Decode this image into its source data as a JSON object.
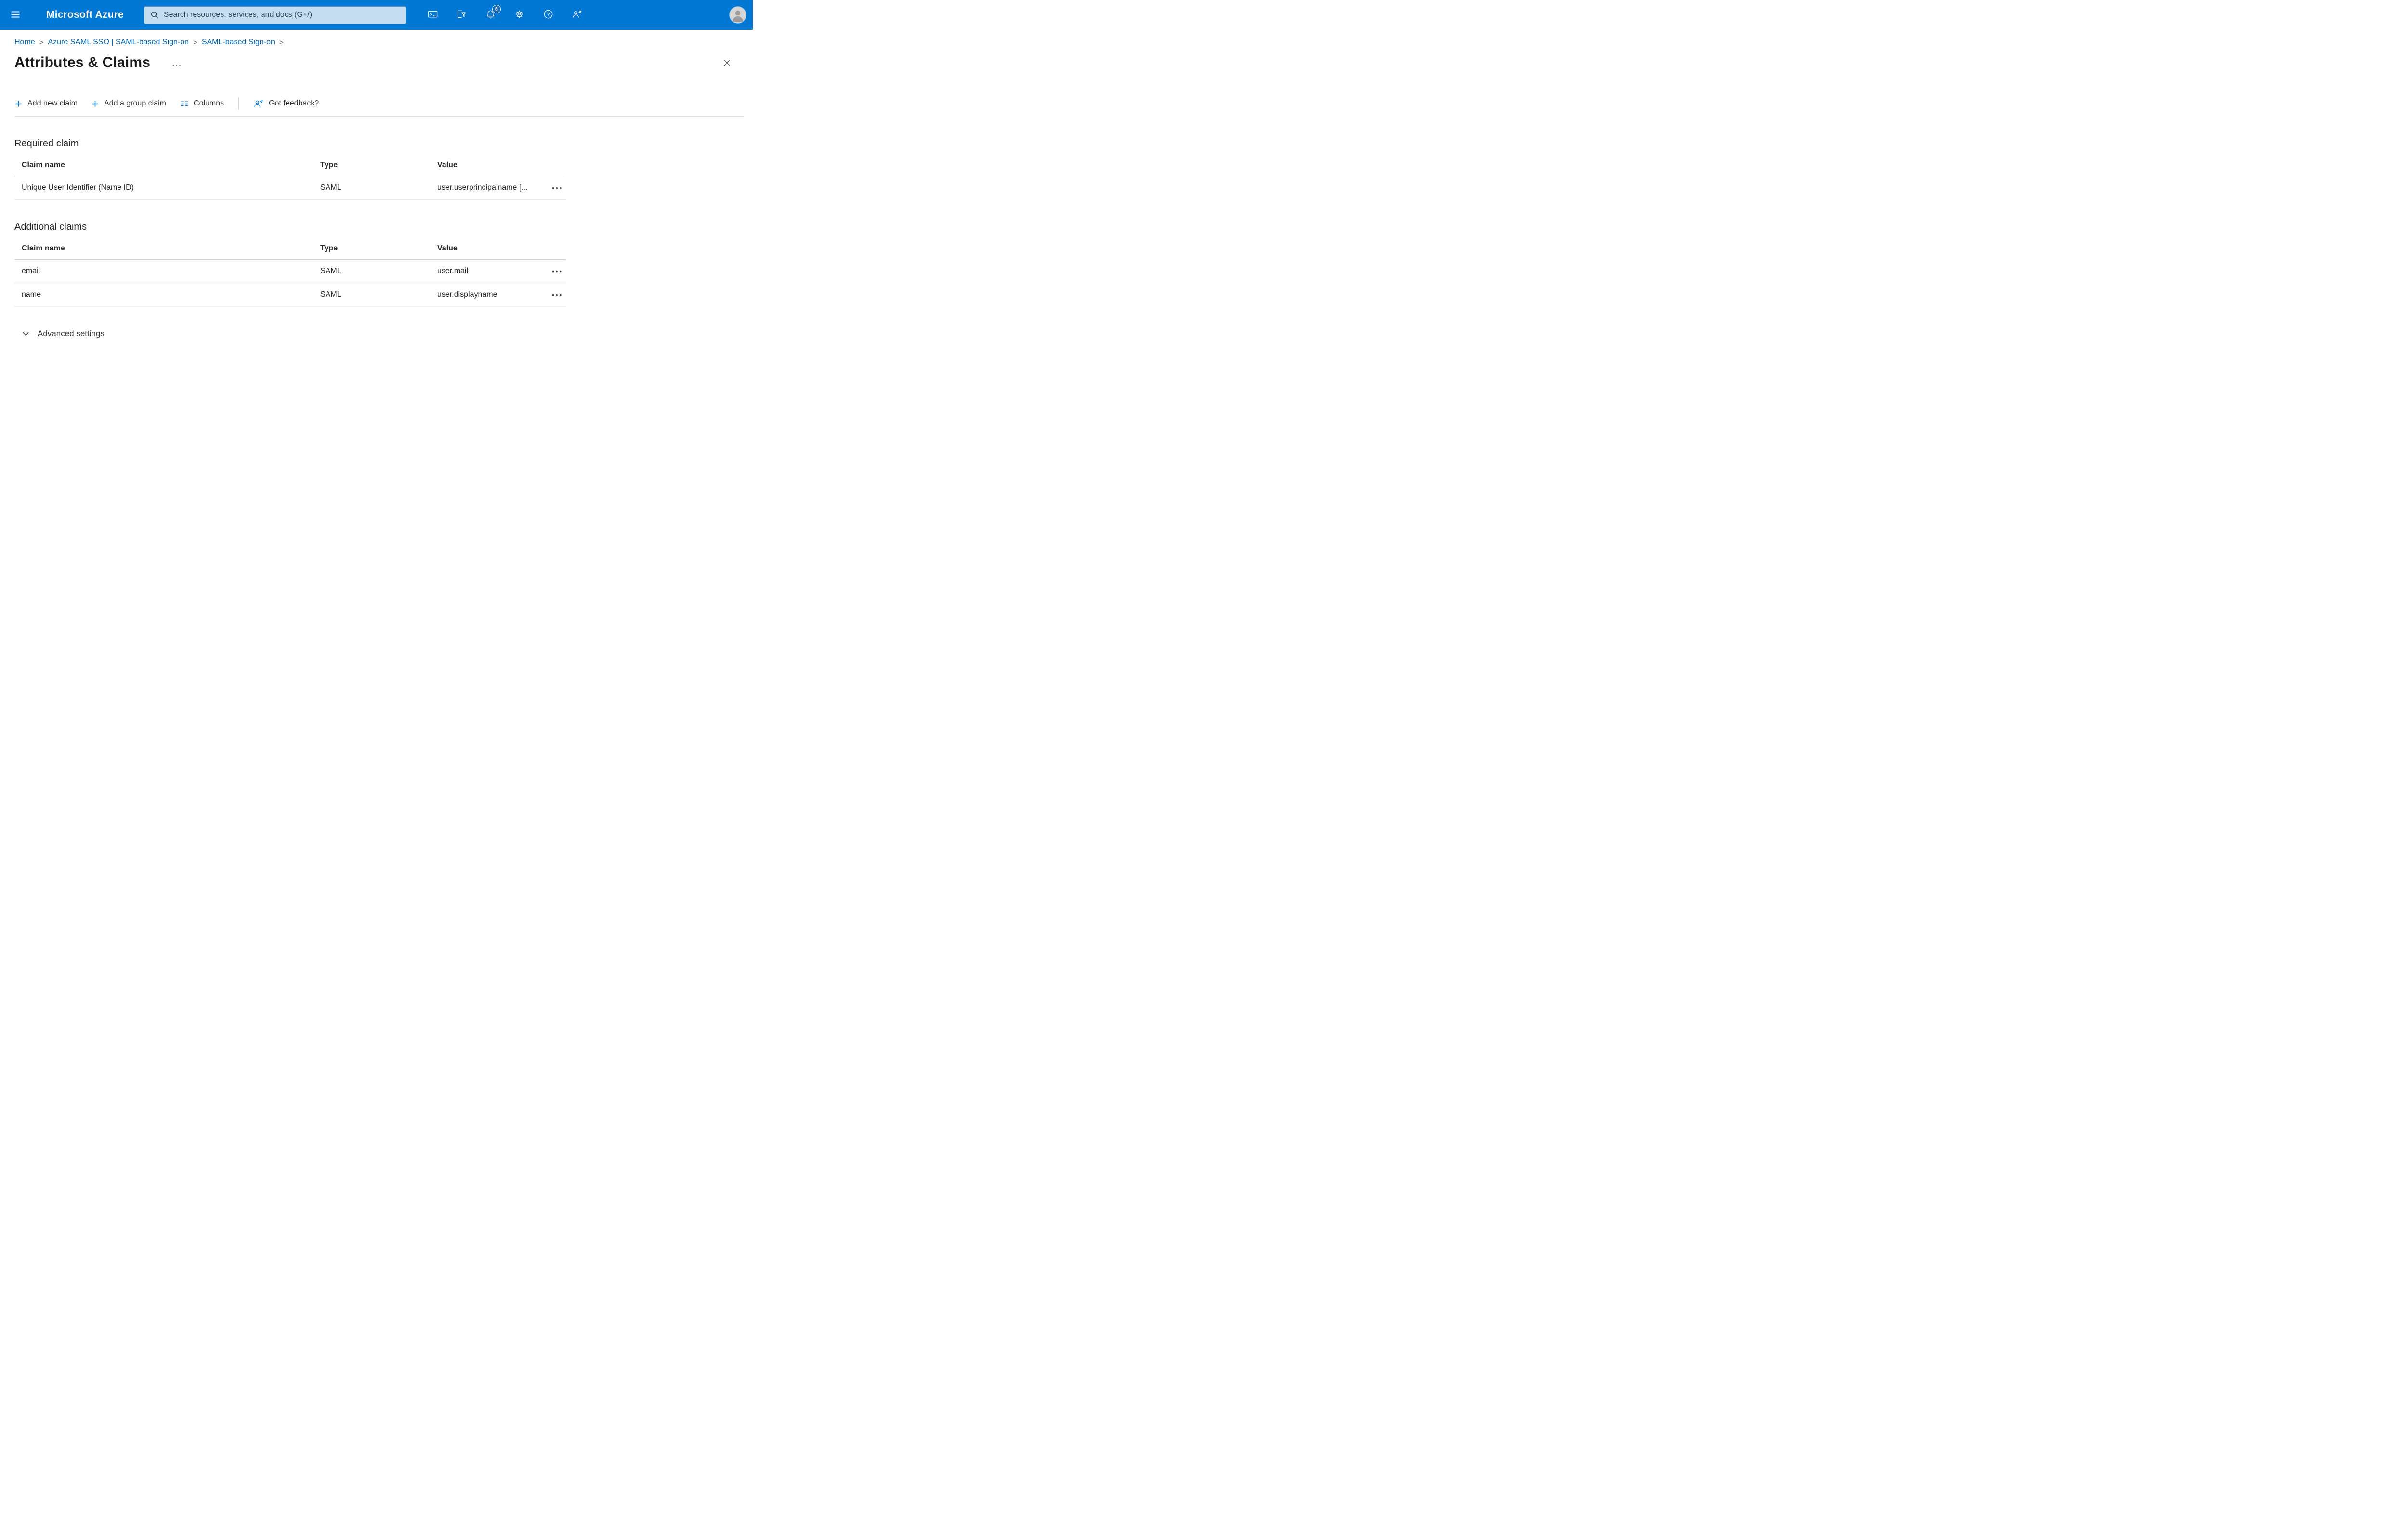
{
  "header": {
    "brand": "Microsoft Azure",
    "search_placeholder": "Search resources, services, and docs (G+/)",
    "notification_count": "6"
  },
  "icons": {
    "page_menu": "…",
    "row_menu": "•••",
    "breadcrumb_separator": ">"
  },
  "breadcrumb": {
    "items": [
      {
        "label": "Home"
      },
      {
        "label": "Azure SAML SSO | SAML-based Sign-on"
      },
      {
        "label": "SAML-based Sign-on"
      }
    ]
  },
  "page": {
    "title": "Attributes & Claims"
  },
  "toolbar": {
    "add_new_claim": "Add new claim",
    "add_group_claim": "Add a group claim",
    "columns": "Columns",
    "got_feedback": "Got feedback?"
  },
  "required_claim": {
    "heading": "Required claim",
    "columns": {
      "name": "Claim name",
      "type": "Type",
      "value": "Value"
    },
    "rows": [
      {
        "name": "Unique User Identifier (Name ID)",
        "type": "SAML",
        "value": "user.userprincipalname [..."
      }
    ]
  },
  "additional_claims": {
    "heading": "Additional claims",
    "columns": {
      "name": "Claim name",
      "type": "Type",
      "value": "Value"
    },
    "rows": [
      {
        "name": "email",
        "type": "SAML",
        "value": "user.mail"
      },
      {
        "name": "name",
        "type": "SAML",
        "value": "user.displayname"
      }
    ]
  },
  "advanced": {
    "label": "Advanced settings"
  },
  "colors": {
    "accent": "#0078d4"
  }
}
